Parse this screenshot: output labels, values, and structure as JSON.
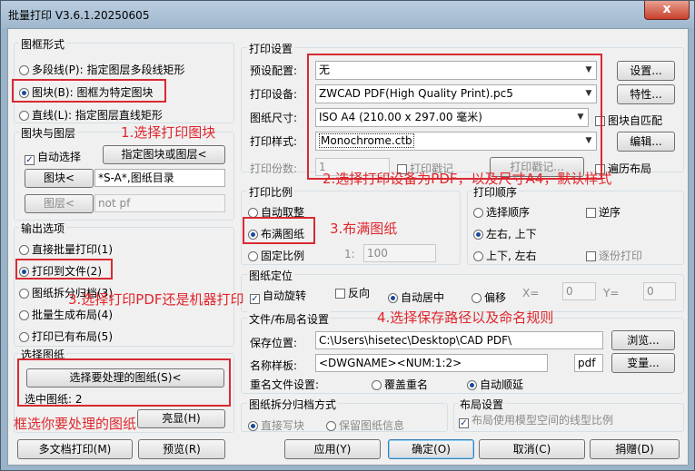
{
  "window": {
    "title": "批量打印 V3.6.1.20250605",
    "close_label": "x"
  },
  "frame_form": {
    "title": "图框形式",
    "polyline": "多段线(P): 指定图层多段线矩形",
    "block": "图块(B): 图框为特定图块",
    "line": "直线(L): 指定图层直线矩形"
  },
  "block_layer": {
    "title": "图块与图层",
    "auto_select": "自动选择",
    "specify_btn": "指定图块或图层<",
    "block_btn": "图块<",
    "block_value": "*S-A*,图纸目录",
    "layer_btn": "图层<",
    "layer_value": "not pf"
  },
  "output": {
    "title": "输出选项",
    "direct_print": "直接批量打印(1)",
    "print_to_file": "打印到文件(2)",
    "split_archive": "图纸拆分归档(3)",
    "batch_layout": "批量生成布局(4)",
    "print_layout": "打印已有布局(5)"
  },
  "select_sheets": {
    "title": "选择图纸",
    "select_btn": "选择要处理的图纸(S)<",
    "selected": "选中图纸: 2",
    "highlight_btn": "亮显(H)"
  },
  "print_settings": {
    "title": "打印设置",
    "preset_label": "预设配置:",
    "preset_value": "无",
    "setup_btn": "设置...",
    "device_label": "打印设备:",
    "device_value": "ZWCAD PDF(High Quality Print).pc5",
    "props_btn": "特性...",
    "size_label": "图纸尺寸:",
    "size_value": "ISO A4 (210.00 x 297.00 毫米)",
    "block_match": "图块自匹配",
    "style_label": "打印样式:",
    "style_value": "Monochrome.ctb",
    "edit_btn": "编辑...",
    "copies_label": "打印份数:",
    "copies_value": "1",
    "stamp": "打印戳记",
    "stamp_btn": "打印戳记...",
    "traverse_layout": "遍历布局"
  },
  "scale": {
    "title": "打印比例",
    "auto_fit": "自动取整",
    "fill": "布满图纸",
    "fixed": "固定比例",
    "ratio_label": "1:",
    "ratio_value": "100"
  },
  "order": {
    "title": "打印顺序",
    "select_order": "选择顺序",
    "reverse": "逆序",
    "lr_tb": "左右, 上下",
    "tb_lr": "上下, 左右",
    "one_by_one": "逐份打印"
  },
  "positioning": {
    "title": "图纸定位",
    "auto_rotate": "自动旋转",
    "flip": "反向",
    "auto_center": "自动居中",
    "offset": "偏移",
    "x_label": "X=",
    "x_value": "0",
    "y_label": "Y=",
    "y_value": "0"
  },
  "file_naming": {
    "title": "文件/布局名设置",
    "save_label": "保存位置:",
    "save_value": "C:\\Users\\hisetec\\Desktop\\CAD PDF\\",
    "browse_btn": "浏览...",
    "name_label": "名称样板:",
    "name_value": "<DWGNAME><NUM:1:2>",
    "ext_value": "pdf",
    "vars_btn": "变量...",
    "rename_label": "重名文件设置:",
    "overwrite": "覆盖重名",
    "auto_inc": "自动顺延"
  },
  "split_mode": {
    "title": "图纸拆分归档方式",
    "direct_write": "直接写块",
    "keep_info": "保留图纸信息"
  },
  "layout_settings": {
    "title": "布局设置",
    "model_linetype": "布局使用模型空间的线型比例"
  },
  "bottom": {
    "multi_print": "多文档打印(M)",
    "preview": "预览(R)",
    "apply": "应用(Y)",
    "ok": "确定(O)",
    "cancel": "取消(C)",
    "donate": "捐赠(D)"
  },
  "annotations": {
    "a1": "1.选择打印图块",
    "a2": "2.选择打印设备为PDF，以及尺寸A4，默认样式",
    "a3": "3.布满图纸",
    "a3b": "3.选择打印PDF还是机器打印",
    "a4": "4.选择保存路径以及命名规则",
    "a5": "框选你要处理的图纸"
  },
  "colors": {
    "annotation": "#e0262c",
    "titlebar": "#9fb7cd",
    "dialog": "#f0f0f0"
  }
}
